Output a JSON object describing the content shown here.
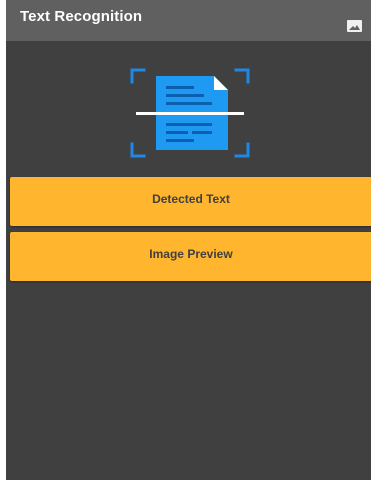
{
  "app_bar": {
    "title": "Text Recognition",
    "action_icon": "image-icon"
  },
  "header_icon": "document-scan-icon",
  "buttons": {
    "detected_text": "Detected Text",
    "image_preview": "Image Preview"
  },
  "colors": {
    "app_bar": "#606060",
    "background": "#404040",
    "button": "#ffb52e",
    "button_text": "#404040",
    "icon_blue": "#1e9af2"
  }
}
